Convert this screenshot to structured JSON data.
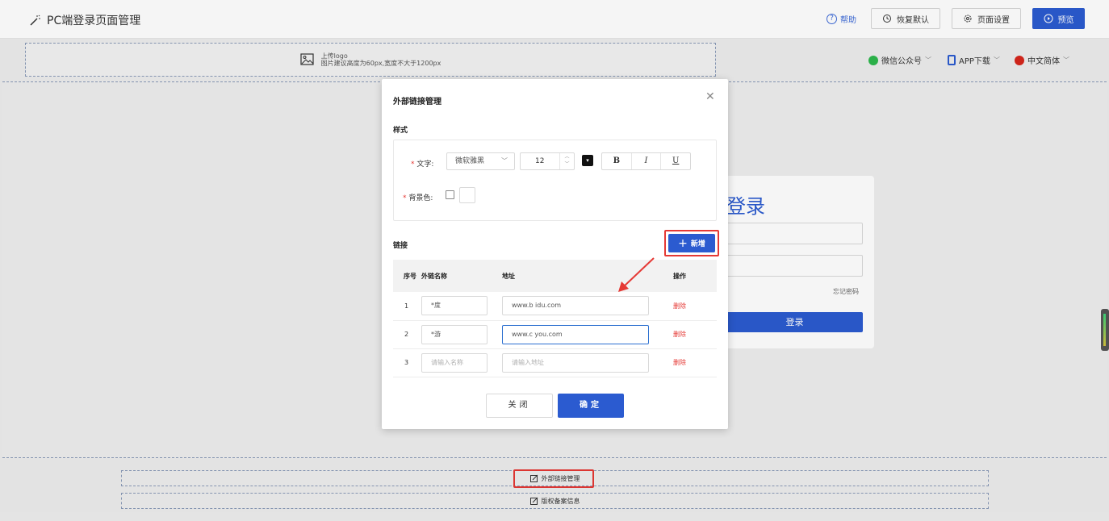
{
  "header": {
    "title": "PC端登录页面管理",
    "help": "帮助",
    "restore_default": "恢复默认",
    "page_settings": "页面设置",
    "preview": "预览"
  },
  "logo_zone": {
    "line1": "上传logo",
    "line2": "图片建议高度为60px,宽度不大于1200px"
  },
  "header_links": {
    "wechat": "微信公众号",
    "app": "APP下载",
    "language": "中文简体"
  },
  "login_preview": {
    "title": "登录",
    "forgot": "忘记密码",
    "button": "登录"
  },
  "footer": {
    "external_links": "外部链接管理",
    "copyright": "版权备案信息"
  },
  "modal": {
    "title": "外部链接管理",
    "style_section": "样式",
    "text_label": "文字:",
    "font_family": "微软雅黑",
    "font_size": "12",
    "bold": "B",
    "italic": "I",
    "underline": "U",
    "bg_label": "背景色:",
    "links_section": "链接",
    "add_button": "新增",
    "columns": {
      "index": "序号",
      "name": "外链名称",
      "address": "地址",
      "action": "操作"
    },
    "rows": [
      {
        "index": "1",
        "name": "*度",
        "address": "www.b  idu.com",
        "action": "删除"
      },
      {
        "index": "2",
        "name": "*游",
        "address": "www.c     you.com",
        "action": "删除"
      },
      {
        "index": "3",
        "name_placeholder": "请输入名称",
        "address_placeholder": "请输入地址",
        "action": "删除"
      }
    ],
    "close_button": "关闭",
    "confirm_button": "确定"
  },
  "colors": {
    "primary": "#2b5bd0",
    "danger": "#e53935",
    "highlight": "#e53935"
  }
}
